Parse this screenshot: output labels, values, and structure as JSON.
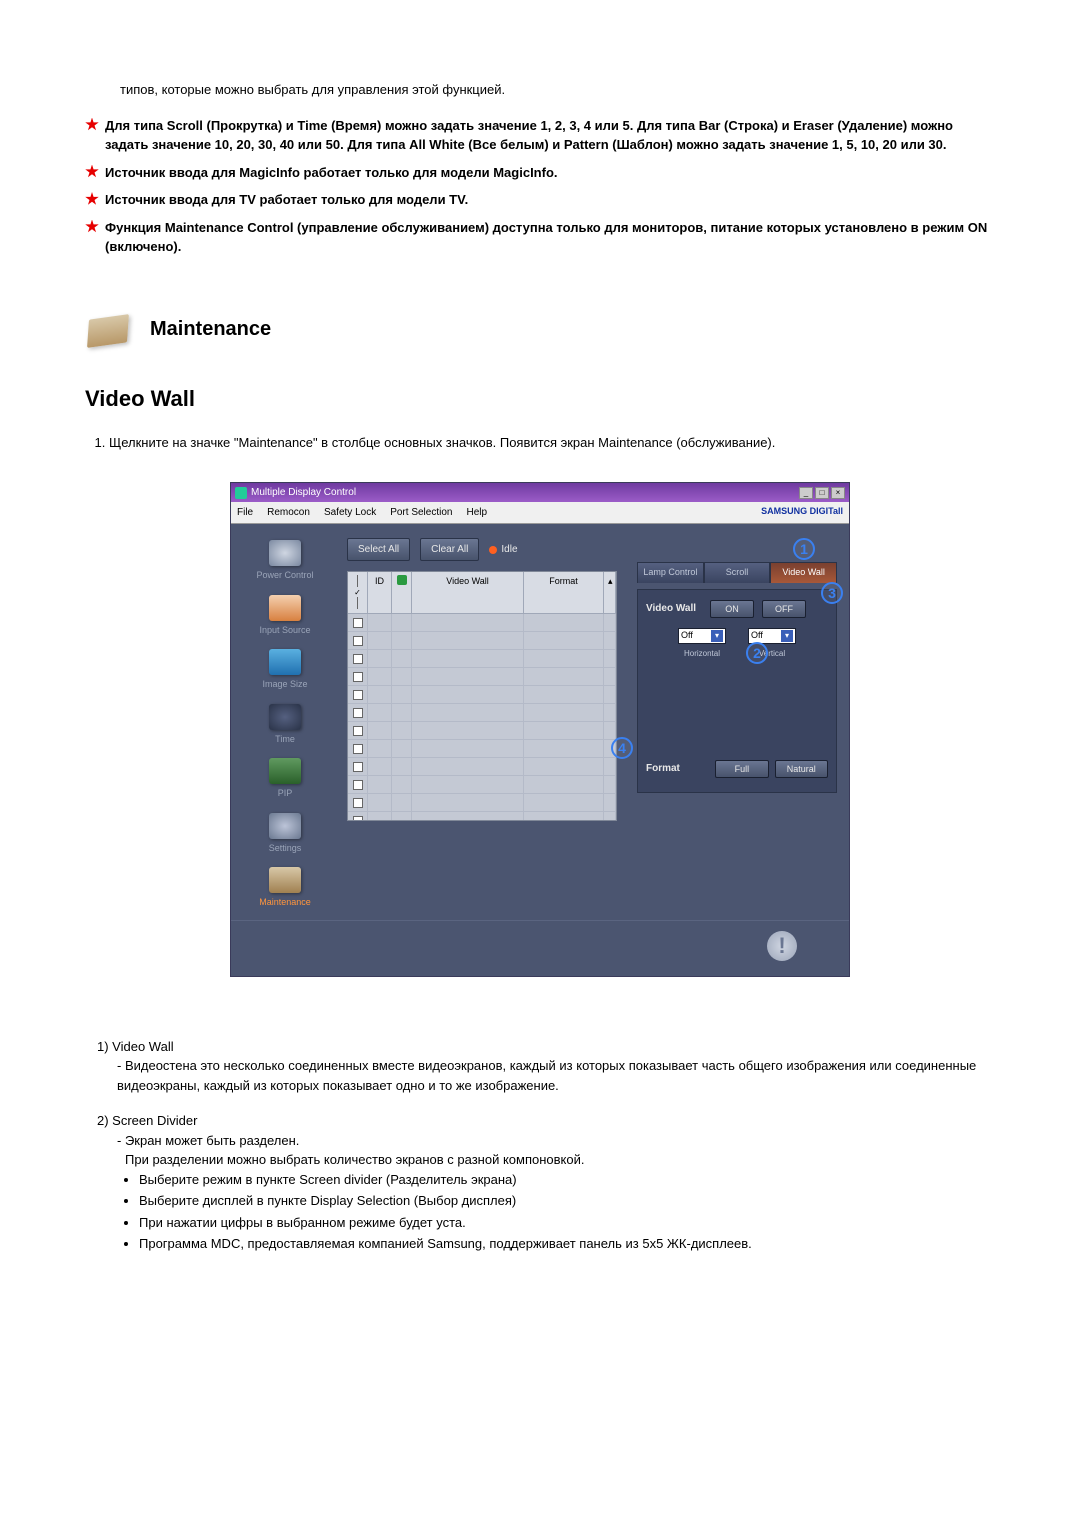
{
  "top_line": "типов, которые можно выбрать для управления этой функцией.",
  "stars": [
    "Для типа Scroll (Прокрутка) и Time (Время) можно задать значение 1, 2, 3, 4 или 5. Для типа Bar (Строка) и Eraser (Удаление) можно задать значение 10, 20, 30, 40 или 50. Для типа All White (Все белым) и Pattern (Шаблон) можно задать значение 1, 5, 10, 20 или 30.",
    "Источник ввода для MagicInfo работает только для модели MagicInfo.",
    "Источник ввода для TV работает только для модели TV.",
    "Функция Maintenance Control (управление обслуживанием) доступна только для мониторов, питание которых установлено в режим ON (включено)."
  ],
  "maintenance_heading": "Maintenance",
  "video_wall_heading": "Video Wall",
  "intro_item": "Щелкните на значке \"Maintenance\" в столбце основных значков. Появится экран Maintenance (обслуживание).",
  "mdc": {
    "title": "Multiple Display Control",
    "menus": [
      "File",
      "Remocon",
      "Safety Lock",
      "Port Selection",
      "Help"
    ],
    "brand": "SAMSUNG DIGITall",
    "sidebar": [
      {
        "label": "Power Control",
        "cls": "pc"
      },
      {
        "label": "Input Source",
        "cls": "input"
      },
      {
        "label": "Image Size",
        "cls": "img"
      },
      {
        "label": "Time",
        "cls": "timepc"
      },
      {
        "label": "PIP",
        "cls": "pip"
      },
      {
        "label": "Settings",
        "cls": "set"
      },
      {
        "label": "Maintenance",
        "cls": "maint",
        "active": true
      }
    ],
    "select_all": "Select All",
    "clear_all": "Clear All",
    "idle": "Idle",
    "table_headers": {
      "c1": "",
      "c2": "ID",
      "c3": "",
      "c4": "Video Wall",
      "c5": "Format"
    },
    "tabs": {
      "lamp": "Lamp Control",
      "scroll": "Scroll",
      "videowall": "Video Wall"
    },
    "videowall_label": "Video Wall",
    "on": "ON",
    "off": "OFF",
    "h_select": "Off",
    "v_select": "Off",
    "h_caption": "Horizontal",
    "v_caption": "Vertical",
    "format_label": "Format",
    "full": "Full",
    "natural": "Natural"
  },
  "callouts": {
    "c1": "1",
    "c2": "2",
    "c3": "3",
    "c4": "4"
  },
  "bottom": {
    "i1_title": "1)  Video Wall",
    "i1_body": "- Видеостена это несколько соединенных вместе видеоэкранов, каждый из которых показывает часть общего изображения или соединенные видеоэкраны, каждый из которых показывает одно и то же изображение.",
    "i2_title": "2)  Screen Divider",
    "i2_line1": "- Экран может быть разделен.",
    "i2_line2": "При разделении можно выбрать количество экранов с разной компоновкой.",
    "i2_bullets": [
      "Выберите режим в пункте Screen divider (Разделитель экрана)",
      "Выберите дисплей в пункте Display Selection (Выбор дисплея)",
      "При нажатии цифры в выбранном режиме будет уста.",
      "Программа MDC, предоставляемая компанией Samsung, поддерживает панель из 5x5 ЖК-дисплеев."
    ]
  }
}
